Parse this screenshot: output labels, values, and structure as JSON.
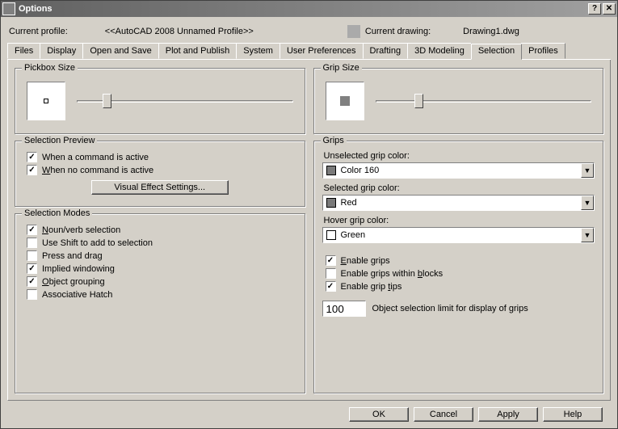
{
  "window": {
    "title": "Options"
  },
  "header": {
    "current_profile_label": "Current profile:",
    "current_profile_value": "<<AutoCAD 2008 Unnamed Profile>>",
    "current_drawing_label": "Current drawing:",
    "current_drawing_value": "Drawing1.dwg"
  },
  "tabs": {
    "files": "Files",
    "display": "Display",
    "open_and_save": "Open and Save",
    "plot_and_publish": "Plot and Publish",
    "system": "System",
    "user_preferences": "User Preferences",
    "drafting": "Drafting",
    "modeling_3d": "3D Modeling",
    "selection": "Selection",
    "profiles": "Profiles"
  },
  "pickbox": {
    "legend": "Pickbox Size",
    "slider_percent": 12
  },
  "gripsize": {
    "legend": "Grip Size",
    "slider_percent": 18
  },
  "selection_preview": {
    "legend": "Selection Preview",
    "when_command_active": "When a command is active",
    "when_no_command_active": "When no command is active",
    "visual_effect_button": "Visual Effect Settings..."
  },
  "selection_modes": {
    "legend": "Selection Modes",
    "noun_verb": "Noun/verb selection",
    "use_shift": "Use Shift to add to selection",
    "press_drag": "Press and drag",
    "implied_window": "Implied windowing",
    "object_grouping": "Object grouping",
    "assoc_hatch": "Associative Hatch"
  },
  "grips": {
    "legend": "Grips",
    "unselected_label": "Unselected grip color:",
    "unselected_value": "Color 160",
    "unselected_swatch": "#7a7a7a",
    "selected_label": "Selected grip color:",
    "selected_value": "Red",
    "selected_swatch": "#7a7a7a",
    "hover_label": "Hover grip color:",
    "hover_value": "Green",
    "hover_swatch": "#ffffff",
    "enable_grips": "Enable grips",
    "enable_blocks": "Enable grips within blocks",
    "enable_tips": "Enable grip tips",
    "limit_value": "100",
    "limit_label": "Object selection limit for display of grips"
  },
  "buttons": {
    "ok": "OK",
    "cancel": "Cancel",
    "apply": "Apply",
    "help": "Help"
  }
}
